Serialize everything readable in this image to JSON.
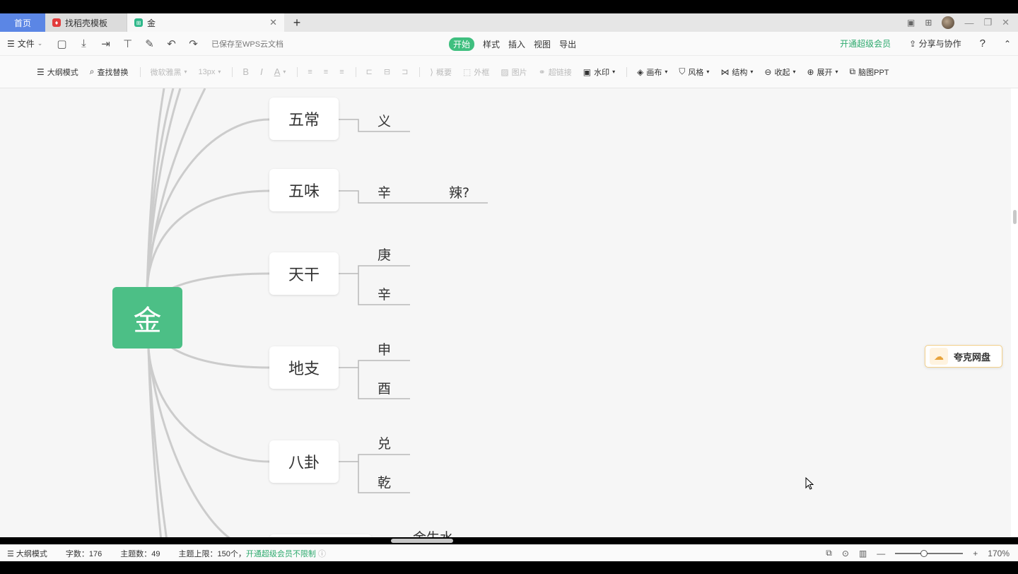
{
  "tabs": {
    "home": "首页",
    "templates": "找稻壳模板",
    "doc": "金",
    "new_tab": "+"
  },
  "menu": {
    "file": "文件",
    "saved_status": "已保存至WPS云文档",
    "center_tabs": [
      "开始",
      "样式",
      "插入",
      "视图",
      "导出"
    ],
    "active_tab": "开始",
    "vip": "开通超级会员",
    "share": "分享与协作",
    "help": "?"
  },
  "toolbar": {
    "outline": "大纲模式",
    "find_replace": "查找替换",
    "font": "微软雅黑",
    "size": "13px",
    "bold": "B",
    "italic": "I",
    "color": "A",
    "summary": "概要",
    "frame": "外框",
    "image": "图片",
    "link": "超链接",
    "watermark": "水印",
    "canvas": "画布",
    "style": "风格",
    "structure": "结构",
    "collapse": "收起",
    "expand": "展开",
    "ppt": "脑图PPT"
  },
  "mindmap": {
    "root": "金",
    "nodes": [
      {
        "label": "五常",
        "children": [
          "义"
        ]
      },
      {
        "label": "五味",
        "children": [
          "辛",
          "辣?"
        ]
      },
      {
        "label": "天干",
        "children": [
          "庚",
          "辛"
        ]
      },
      {
        "label": "地支",
        "children": [
          "申",
          "酉"
        ]
      },
      {
        "label": "八卦",
        "children": [
          "兑",
          "乾"
        ]
      }
    ],
    "partial_text": "金生水"
  },
  "quark": {
    "label": "夸克网盘"
  },
  "status": {
    "mode": "大纲模式",
    "word_count": "字数：176",
    "topic_count": "主题数：49",
    "topic_limit": "主题上限：150个，",
    "upgrade": "开通超级会员不限制",
    "zoom": "170%"
  },
  "colors": {
    "root": "#4cbf86",
    "accent": "#3fbf7f",
    "home_tab": "#5b86e5"
  }
}
